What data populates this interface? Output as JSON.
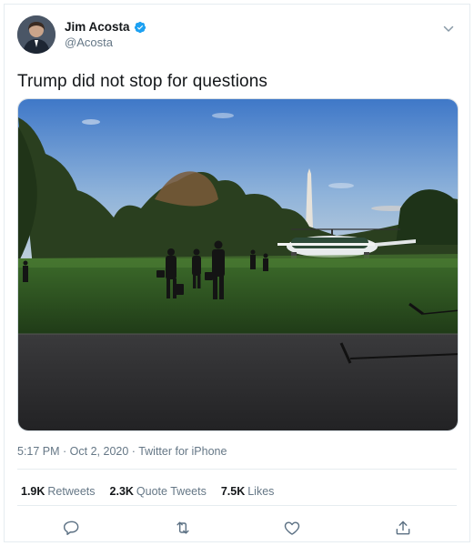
{
  "user": {
    "display_name": "Jim Acosta",
    "handle": "@Acosta",
    "verified": true
  },
  "tweet": {
    "text": "Trump did not stop for questions",
    "time": "5:17 PM",
    "date": "Oct 2, 2020",
    "source": "Twitter for iPhone",
    "separator": " · "
  },
  "stats": [
    {
      "count": "1.9K",
      "label": "Retweets"
    },
    {
      "count": "2.3K",
      "label": "Quote Tweets"
    },
    {
      "count": "7.5K",
      "label": "Likes"
    }
  ],
  "icons": {
    "menu": "chevron-down-icon",
    "verified": "verified-badge-icon",
    "actions": [
      "reply-icon",
      "retweet-icon",
      "like-icon",
      "share-icon"
    ]
  },
  "colors": {
    "verified": "#1da1f2",
    "secondary_text": "#657786",
    "border": "#e6ecf0"
  }
}
